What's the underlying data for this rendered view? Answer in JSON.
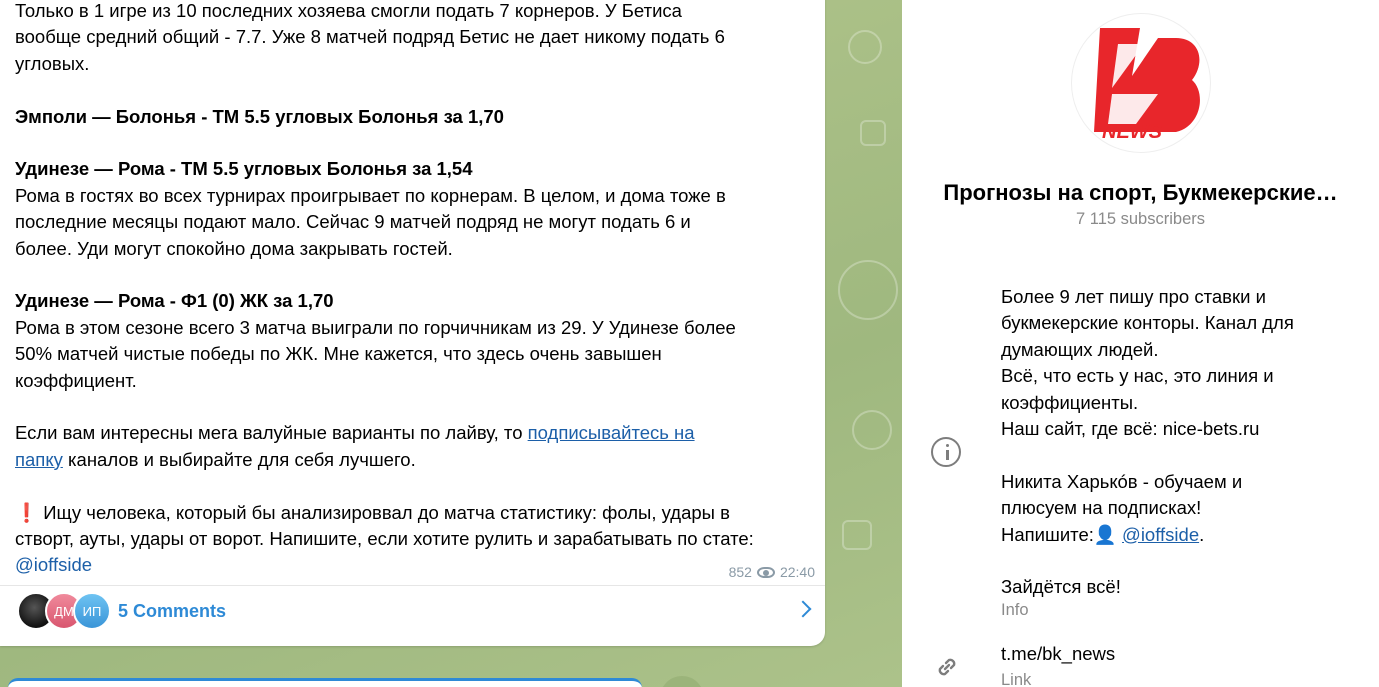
{
  "message": {
    "line1": "Только в 1 игре из 10 последних хозяева смогли подать 7 корнеров. У Бетиса",
    "line2": "вообще средний общий - 7.7. Уже 8 матчей подряд Бетис не дает никому подать 6",
    "line3": "угловых.",
    "bet1": "Эмполи — Болонья - ТМ 5.5 угловых Болонья за 1,70",
    "bet2": "Удинезе — Рома - ТМ 5.5 угловых Болонья за 1,54",
    "bet2_text": "Рома в гостях во всех турнирах проигрывает по корнерам. В целом, и дома тоже в\nпоследние месяцы подают мало. Сейчас 9 матчей подряд не могут подать 6 и\nболее. Уди могут спокойно дома закрывать гостей.",
    "bet3": "Удинезе — Рома - Ф1 (0) ЖК за 1,70",
    "bet3_text": "Рома в этом сезоне всего 3 матча выиграли по горчичникам из 29. У Удинезе более\n50% матчей чистые победы по ЖК. Мне кажется, что здесь очень завышен\nкоэффициент.",
    "promo_before": "Если вам интересны мега валуйные варианты по лайву, то ",
    "promo_link1": "подписывайтесь на",
    "promo_link2": "папку",
    "promo_after": " каналов и выбирайте для себя лучшего.",
    "alert_mark": "❗",
    "search_text": "Ищу человека, который бы анализироввал до матча статистику: фолы, удары в\nстворт, ауты, удары от ворот. Напишите, если хотите рулить и зарабатывать по стате:",
    "mention": "@ioffside",
    "views": "852",
    "time": "22:40"
  },
  "comments": {
    "avatar2": "ДМ",
    "avatar3": "ИП",
    "label": "5 Comments"
  },
  "channel": {
    "logo_text": "NEWS",
    "title": "Прогнозы на спорт, Букмекерские…",
    "subscribers": "7 115 subscribers",
    "about1": "Более 9 лет пишу про ставки и\nбукмекерские конторы. Канал для\nдумающих людей.\nВсё, что есть у нас, это линия и\nкоэффициенты.\nНаш сайт, где всё: nice-bets.ru",
    "about2": "Никита Харькóв - обучаем и\nплюсуем на подписках!",
    "about3_prefix": "Напишите:👤 ",
    "about3_mention": "@ioffside",
    "about3_suffix": ".",
    "about4": "Зайдётся всё!",
    "info_label": "Info",
    "link": "t.me/bk_news",
    "link_label": "Link"
  },
  "colors": {
    "accent": "#2e8ad6",
    "link": "#1c5fa8",
    "logo_red": "#e8262b",
    "chat_bg": "#a9bf86"
  }
}
